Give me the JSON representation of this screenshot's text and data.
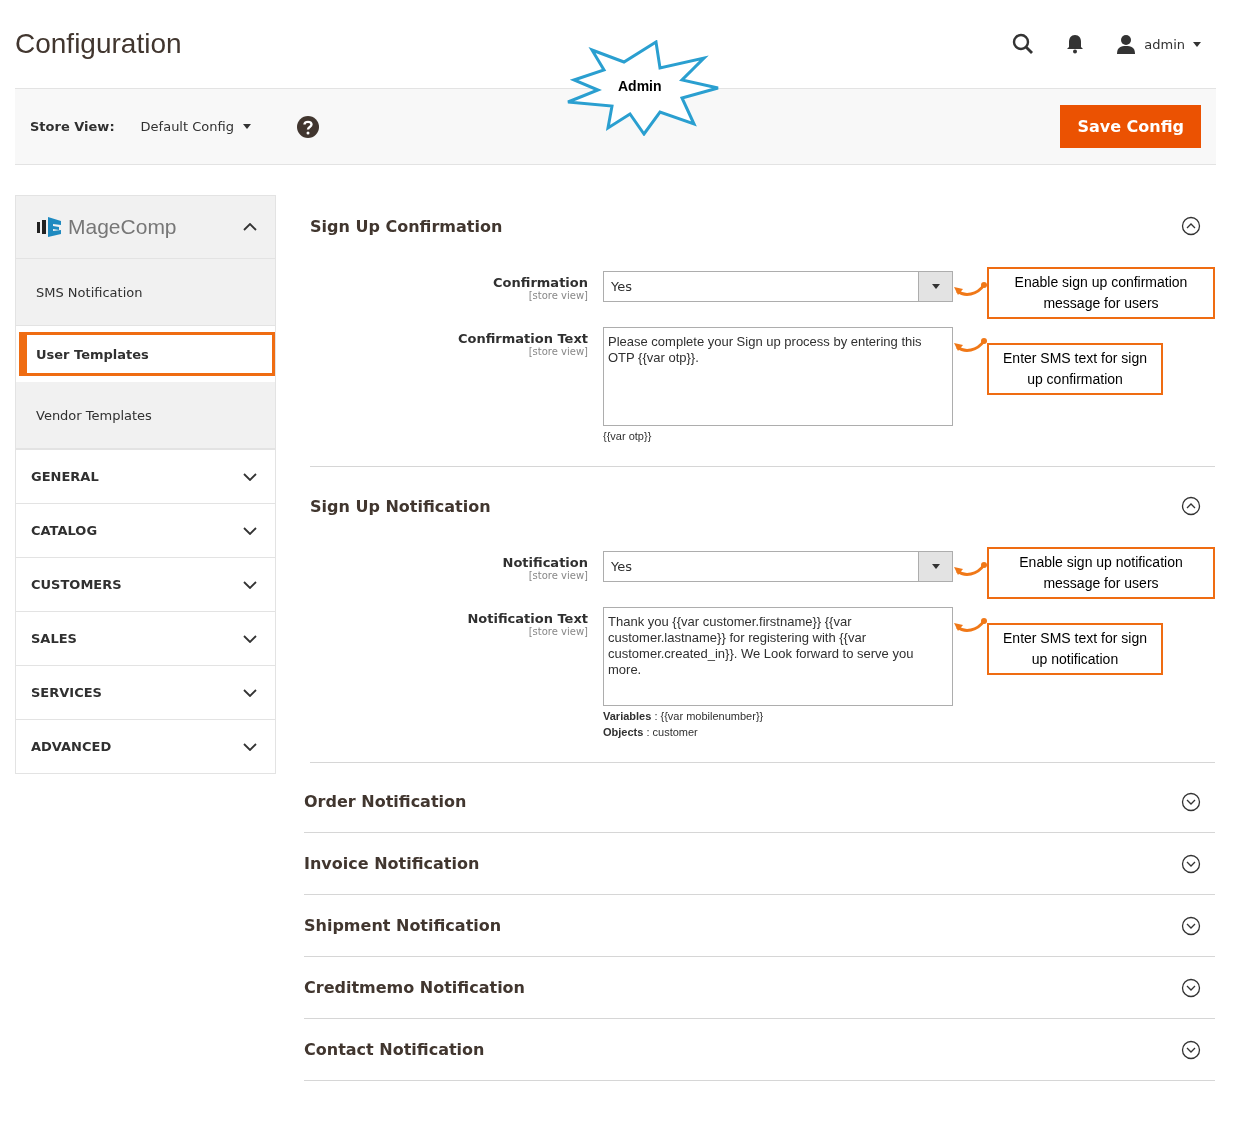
{
  "page_title": "Configuration",
  "header": {
    "user": "admin"
  },
  "callout": "Admin",
  "store_view": {
    "label": "Store View:",
    "value": "Default Config"
  },
  "save_button": "Save Config",
  "sidebar": {
    "group": {
      "brand": "MageComp",
      "expanded": true,
      "items": [
        {
          "label": "SMS Notification",
          "selected": false
        },
        {
          "label": "User Templates",
          "selected": true
        },
        {
          "label": "Vendor Templates",
          "selected": false
        }
      ]
    },
    "sections": [
      {
        "label": "GENERAL",
        "expanded": false
      },
      {
        "label": "CATALOG",
        "expanded": false
      },
      {
        "label": "CUSTOMERS",
        "expanded": false
      },
      {
        "label": "SALES",
        "expanded": false
      },
      {
        "label": "SERVICES",
        "expanded": false
      },
      {
        "label": "ADVANCED",
        "expanded": false
      }
    ]
  },
  "sections": [
    {
      "title": "Sign Up Confirmation",
      "expanded": true,
      "fields": [
        {
          "kind": "select",
          "label": "Confirmation",
          "scope": "[store view]",
          "value": "Yes",
          "note": "Enable sign up confirmation message for users"
        },
        {
          "kind": "textarea",
          "label": "Confirmation Text",
          "scope": "[store view]",
          "value": "Please complete your Sign up process by entering this OTP {{var otp}}.",
          "note": "Enter SMS text for sign up confirmation",
          "hints": [
            "{{var otp}}"
          ]
        }
      ]
    },
    {
      "title": "Sign Up Notification",
      "expanded": true,
      "fields": [
        {
          "kind": "select",
          "label": "Notification",
          "scope": "[store view]",
          "value": "Yes",
          "note": "Enable sign up notification message for users"
        },
        {
          "kind": "textarea",
          "label": "Notification Text",
          "scope": "[store view]",
          "value": "Thank you {{var customer.firstname}} {{var customer.lastname}} for registering with {{var customer.created_in}}. We Look forward to serve you more.",
          "note": "Enter SMS text for sign up notification",
          "hints": [
            "**Variables** : {{var mobilenumber}}",
            "**Objects** : customer"
          ]
        }
      ]
    },
    {
      "title": "Order Notification",
      "expanded": false
    },
    {
      "title": "Invoice Notification",
      "expanded": false
    },
    {
      "title": "Shipment Notification",
      "expanded": false
    },
    {
      "title": "Creditmemo Notification",
      "expanded": false
    },
    {
      "title": "Contact Notification",
      "expanded": false
    }
  ]
}
